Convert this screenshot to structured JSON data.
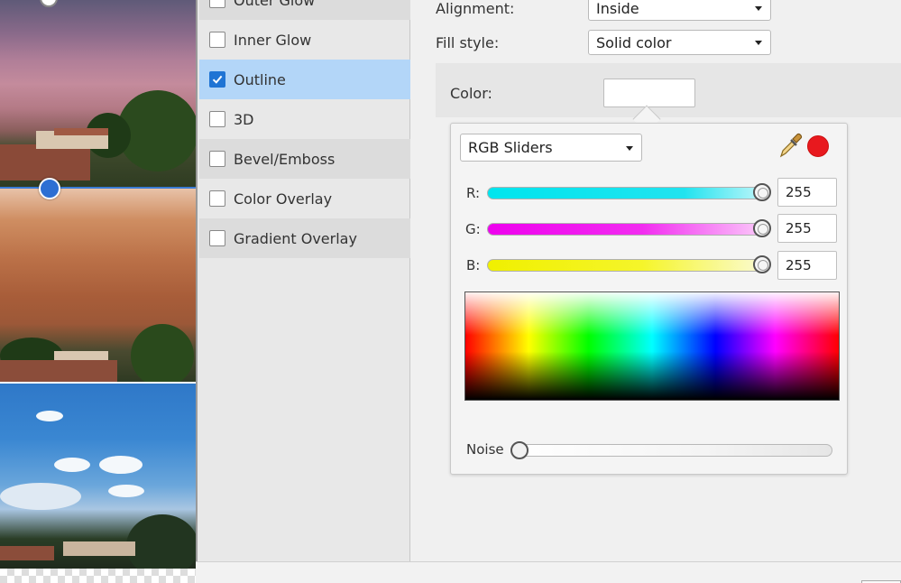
{
  "effects": {
    "items": [
      {
        "label": "Outer Glow",
        "checked": false
      },
      {
        "label": "Inner Glow",
        "checked": false
      },
      {
        "label": "Outline",
        "checked": true
      },
      {
        "label": "3D",
        "checked": false
      },
      {
        "label": "Bevel/Emboss",
        "checked": false
      },
      {
        "label": "Color Overlay",
        "checked": false
      },
      {
        "label": "Gradient Overlay",
        "checked": false
      }
    ],
    "selected": "Outline"
  },
  "properties": {
    "alignment_label": "Alignment:",
    "alignment_value": "Inside",
    "fill_style_label": "Fill style:",
    "fill_style_value": "Solid color",
    "color_label": "Color:",
    "color_value": "#ffffff"
  },
  "picker": {
    "mode": "RGB Sliders",
    "current_color": "#e8191e",
    "channels": [
      {
        "label": "R:",
        "value": "255"
      },
      {
        "label": "G:",
        "value": "255"
      },
      {
        "label": "B:",
        "value": "255"
      }
    ],
    "noise_label": "Noise",
    "noise_value": 0
  },
  "icons": {
    "eyedropper": "eyedropper-icon",
    "checkmark": "checkmark-icon"
  }
}
